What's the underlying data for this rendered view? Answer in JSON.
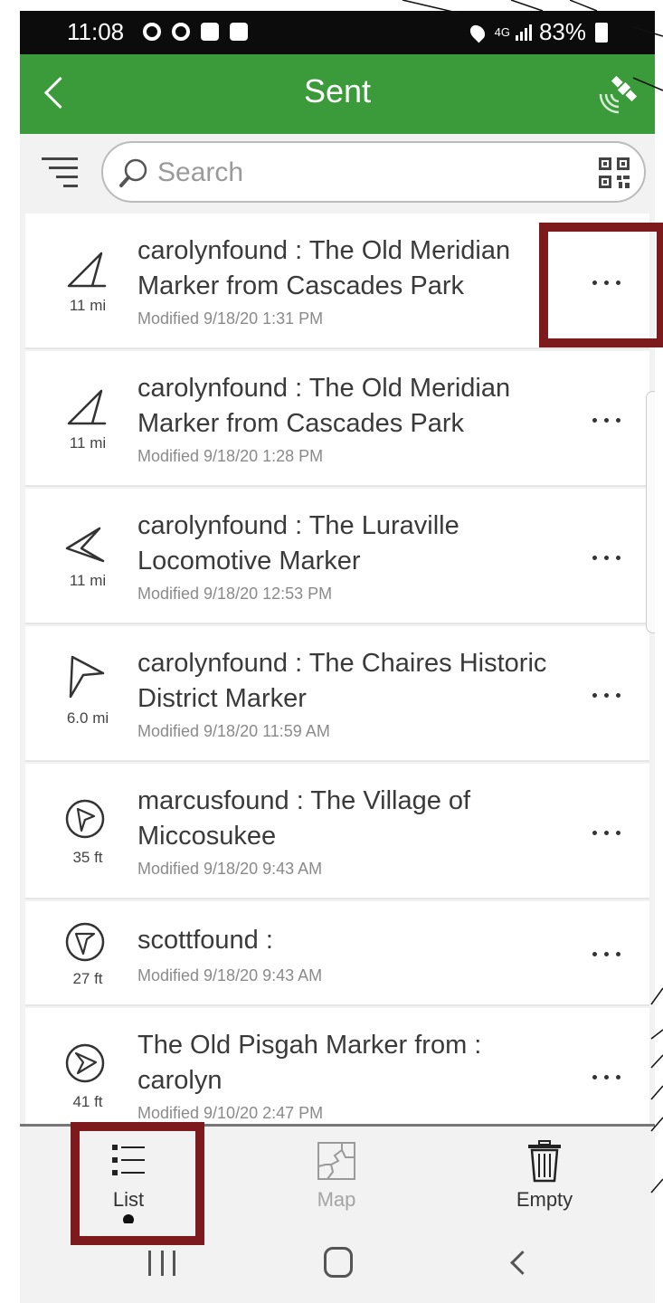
{
  "status_bar": {
    "time": "11:08",
    "network": "4G",
    "battery": "83%"
  },
  "header": {
    "title": "Sent"
  },
  "search": {
    "placeholder": "Search",
    "value": ""
  },
  "list_items": [
    {
      "title": "carolynfound : The Old Meridian Marker from Cascades Park",
      "modified": "Modified 9/18/20 1:31 PM",
      "distance": "11 mi",
      "icon": "direction-arrow-icon"
    },
    {
      "title": "carolynfound : The Old Meridian Marker from Cascades Park",
      "modified": "Modified 9/18/20 1:28 PM",
      "distance": "11 mi",
      "icon": "direction-arrow-icon"
    },
    {
      "title": "carolynfound : The Luraville Locomotive Marker",
      "modified": "Modified 9/18/20 12:53 PM",
      "distance": "11 mi",
      "icon": "direction-arrow-icon"
    },
    {
      "title": "carolynfound : The Chaires Historic District Marker",
      "modified": "Modified 9/18/20 11:59 AM",
      "distance": "6.0 mi",
      "icon": "direction-arrow-icon"
    },
    {
      "title": "marcusfound : The Village of Miccosukee",
      "modified": "Modified 9/18/20 9:43 AM",
      "distance": "35 ft",
      "icon": "circled-direction-icon"
    },
    {
      "title": "scottfound :",
      "modified": "Modified 9/18/20 9:43 AM",
      "distance": "27 ft",
      "icon": "circled-direction-icon"
    },
    {
      "title": "The Old Pisgah Marker from : carolyn",
      "modified": "Modified 9/10/20 2:47 PM",
      "distance": "41 ft",
      "icon": "circled-direction-icon"
    }
  ],
  "tabs": [
    {
      "label": "List",
      "active": true
    },
    {
      "label": "Map",
      "active": false
    },
    {
      "label": "Empty",
      "active": false
    }
  ],
  "colors": {
    "header": "#3b9b3a",
    "highlight": "#7c1a1e"
  }
}
